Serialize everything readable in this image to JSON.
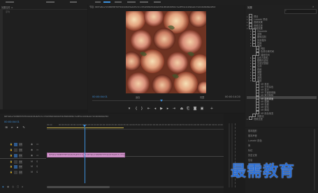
{
  "top_bar": {
    "tabs": [
      "",
      "",
      "",
      "",
      "",
      "",
      "",
      ""
    ],
    "active_tab_index": 4
  },
  "source_panel": {
    "tab_label": "效果控件 ≡",
    "sequence_label": "序列"
  },
  "program_monitor": {
    "title": "节目: 66f7a8ce72486f05f70f7b91b8c05a6d5c3ccd7b45f6bfd40924f34dfb98d9f90c7e4ff34c4dd94a9c72dd2b8b8b42fb3",
    "timecode_left": "00:00:04:01",
    "fit_label": "适合",
    "quality_label": "完整",
    "timecode_right": "00:00:14:20"
  },
  "effects_panel": {
    "title": "效果",
    "search_placeholder": "",
    "tree": [
      {
        "level": 0,
        "label": "预设",
        "open": false
      },
      {
        "level": 0,
        "label": "Lumetri 预设",
        "open": false
      },
      {
        "level": 0,
        "label": "音频效果",
        "open": false
      },
      {
        "level": 0,
        "label": "音频过渡",
        "open": false
      },
      {
        "level": 0,
        "label": "视频效果",
        "open": true
      },
      {
        "level": 1,
        "label": "Obsolete",
        "open": false
      },
      {
        "level": 1,
        "label": "变换",
        "open": false
      },
      {
        "level": 1,
        "label": "图像控制",
        "open": false
      },
      {
        "level": 1,
        "label": "实用程序",
        "open": false
      },
      {
        "level": 1,
        "label": "扭曲",
        "open": false
      },
      {
        "level": 1,
        "label": "时间",
        "open": true
      },
      {
        "level": 2,
        "label": "残影",
        "open": false
      },
      {
        "level": 2,
        "label": "色调分离时间",
        "open": false
      },
      {
        "level": 2,
        "label": "抽帧时间",
        "open": false
      },
      {
        "level": 1,
        "label": "杂色与颗粒",
        "open": false
      },
      {
        "level": 1,
        "label": "模糊与锐化",
        "open": false
      },
      {
        "level": 1,
        "label": "沉浸式视频",
        "open": false
      },
      {
        "level": 1,
        "label": "生成",
        "open": false
      },
      {
        "level": 1,
        "label": "视频",
        "open": false
      },
      {
        "level": 1,
        "label": "调整",
        "open": false
      },
      {
        "level": 1,
        "label": "过渡",
        "open": false
      },
      {
        "level": 1,
        "label": "透视",
        "open": false
      },
      {
        "level": 1,
        "label": "通道",
        "open": true
      },
      {
        "level": 2,
        "label": "VR 投影",
        "open": false
      },
      {
        "level": 2,
        "label": "VR 分形杂色",
        "open": false
      },
      {
        "level": 2,
        "label": "VR 发光",
        "open": false
      },
      {
        "level": 2,
        "label": "VR 平面到球面",
        "open": false
      },
      {
        "level": 2,
        "label": "VR 数字故障",
        "open": false
      },
      {
        "level": 2,
        "label": "VR 旋转球面",
        "open": false
      },
      {
        "level": 2,
        "label": "VR 模糊",
        "open": false
      },
      {
        "level": 2,
        "label": "VR 色差",
        "open": false
      },
      {
        "level": 2,
        "label": "VR 锐化",
        "open": false
      },
      {
        "level": 2,
        "label": "VR 降噪",
        "open": false
      },
      {
        "level": 2,
        "label": "VR 颜色渐变",
        "open": false
      },
      {
        "level": 1,
        "label": "风格化",
        "open": false
      },
      {
        "level": 0,
        "label": "视频过渡",
        "open": false
      }
    ],
    "selected_index": 28,
    "bottom_items": [
      "基本图形",
      "基本声音",
      "Lumetri 颜色",
      "库",
      "标记",
      "历史记录",
      "信息"
    ]
  },
  "timeline": {
    "tab_label": "66f7a8ce72486f05f70f7b91b8c05a6d5c3ccd7b45f6bfd40924f34dfb98d9f90c7e4ff34c4dd94a9c72dd2b8b8b42fb3",
    "timecode": "00:00:04:01",
    "ruler_ticks": [
      "00:00",
      "00:00:05:00",
      "00:00:10:00",
      "00:00:15:00",
      "00:00:20:00",
      "00:00:25:00",
      "00:00:30:00",
      "00:00:35:00",
      "00:00:40:00",
      "00:00:45:00",
      "00:00:50:00",
      "00:00:55:00",
      "00:01:00:00",
      "00:01:05:00",
      "00:01:10:00"
    ],
    "tracks": [
      {
        "name": "V3",
        "kind": "video"
      },
      {
        "name": "V2",
        "kind": "video"
      },
      {
        "name": "V1",
        "kind": "video"
      },
      {
        "name": "A1",
        "kind": "audio"
      },
      {
        "name": "A2",
        "kind": "audio"
      },
      {
        "name": "A3",
        "kind": "audio"
      }
    ],
    "clips": [
      {
        "label": "66f7a8ce72486f05f70f7b91b8c05a6d5c3ccd7b45f6bfd40924f34dfb98d9f9",
        "color": "#d79ad0"
      },
      {
        "label": "fx 66f7a8ce72486f05f70f7b91b8c05a6d5c3ccd7b45f6bfd40924f34dfb98d9f9",
        "color": "#d79ad0"
      }
    ]
  },
  "watermark": {
    "text": "最需教育"
  },
  "colors": {
    "accent": "#3d8fd9",
    "clip": "#d79ad0",
    "panel": "#232323"
  }
}
